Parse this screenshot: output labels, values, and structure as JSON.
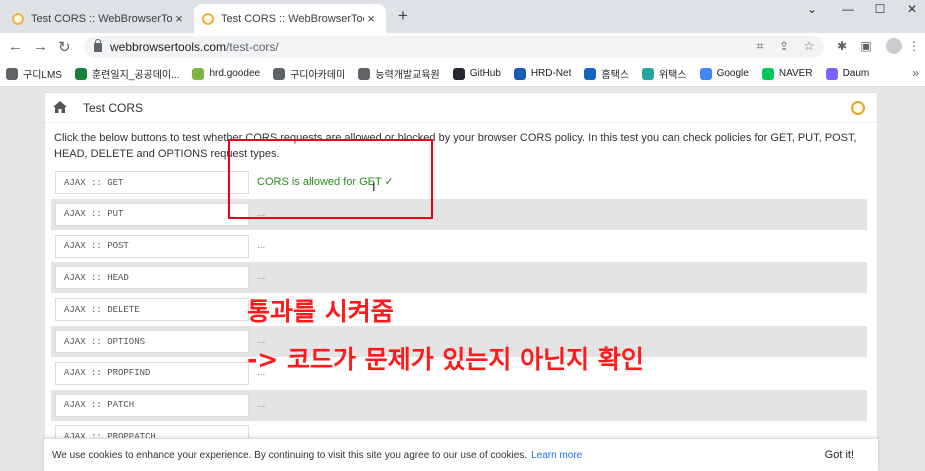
{
  "browser": {
    "tabs": [
      {
        "title": "Test CORS :: WebBrowserTools",
        "close": "×",
        "active": false
      },
      {
        "title": "Test CORS :: WebBrowserTools",
        "close": "×",
        "active": true
      }
    ],
    "new_tab": "+",
    "window_controls": {
      "chevron": "⌄",
      "minimize": "—",
      "maximize": "☐",
      "close": "✕"
    },
    "nav": {
      "back": "←",
      "forward": "→",
      "reload": "↻"
    },
    "url_host": "webbrowsertools.com",
    "url_path": "/test-cors/",
    "toolbar_icons": {
      "translate": "⌗",
      "share": "⇪",
      "star": "☆",
      "extensions": "✱",
      "sidepanel": "▣",
      "menu": "⋮"
    },
    "bookmarks": [
      {
        "label": "구디LMS",
        "color": "#5f6368"
      },
      {
        "label": "훈련일지_공공데이...",
        "color": "#188038"
      },
      {
        "label": "hrd.goodee",
        "color": "#7cb342"
      },
      {
        "label": "구디아카데미",
        "color": "#5f6368"
      },
      {
        "label": "능력개발교육원",
        "color": "#5f6368"
      },
      {
        "label": "GitHub",
        "color": "#24292f"
      },
      {
        "label": "HRD-Net",
        "color": "#1e5bb8"
      },
      {
        "label": "홈택스",
        "color": "#1565c0"
      },
      {
        "label": "위택스",
        "color": "#26a69a"
      },
      {
        "label": "Google",
        "color": "#4285f4"
      },
      {
        "label": "NAVER",
        "color": "#03c75a"
      },
      {
        "label": "Daum",
        "color": "#7b61ff"
      }
    ],
    "bookmarks_more": "»"
  },
  "page": {
    "title": "Test CORS",
    "description": "Click the below buttons to test whether CORS requests are allowed or blocked by your browser CORS policy. In this test you can check policies for GET, PUT, POST, HEAD, DELETE and OPTIONS request types.",
    "rows": [
      {
        "button": "AJAX :: GET",
        "result": "CORS is allowed for GET ✓"
      },
      {
        "button": "AJAX :: PUT",
        "result": "..."
      },
      {
        "button": "AJAX :: POST",
        "result": "..."
      },
      {
        "button": "AJAX :: HEAD",
        "result": "..."
      },
      {
        "button": "AJAX :: DELETE",
        "result": "..."
      },
      {
        "button": "AJAX :: OPTIONS",
        "result": "..."
      },
      {
        "button": "AJAX :: PROPFIND",
        "result": "..."
      },
      {
        "button": "AJAX :: PATCH",
        "result": "..."
      },
      {
        "button": "AJAX :: PROPPATCH",
        "result": ""
      }
    ]
  },
  "annotation": {
    "line1": "통과를 시켜줌",
    "line2": "-> 코드가 문제가 있는지 아닌지 확인",
    "color": "#ff1a1a"
  },
  "cookie_banner": {
    "text": "We use cookies to enhance your experience. By continuing to visit this site you agree to our use of cookies.",
    "learn_more": "Learn more",
    "button": "Got it!"
  },
  "colors": {
    "success": "#2b8a1e",
    "highlight_box": "#e8001c",
    "link": "#1a73e8"
  }
}
